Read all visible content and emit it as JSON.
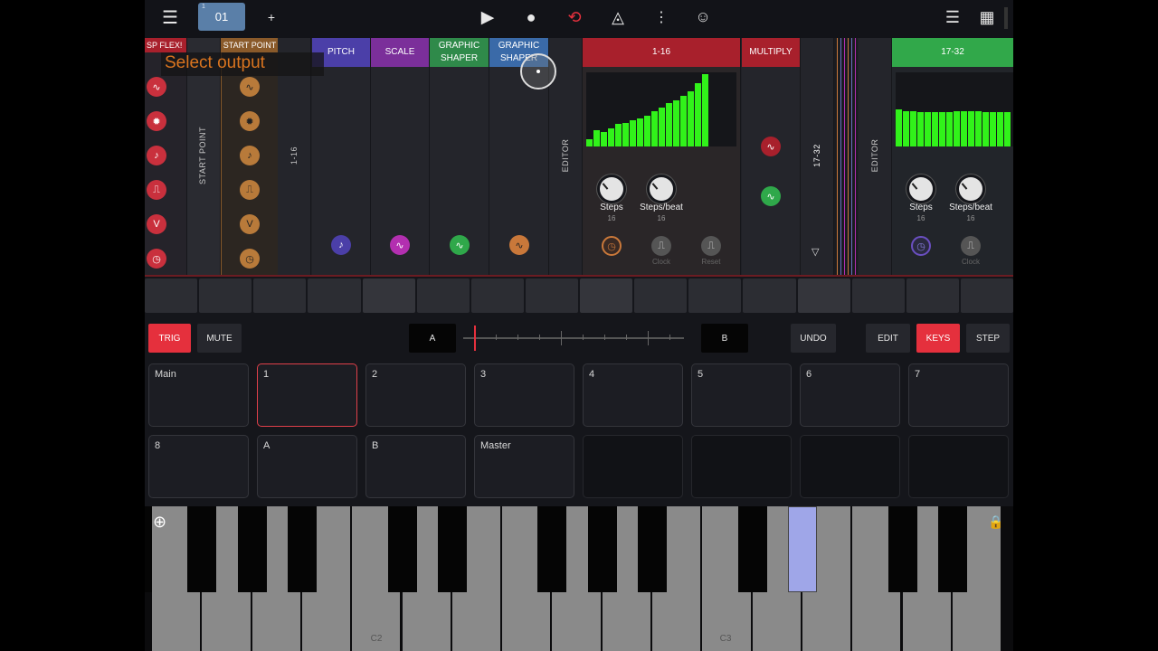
{
  "topbar": {
    "preset_small": "1",
    "preset_label": "01",
    "add_label": "+",
    "play_glyph": "▶",
    "record_glyph": "●",
    "loop_glyph": "⟲",
    "metronome_glyph": "◬",
    "more_glyph": "⋮",
    "face_glyph": "☺",
    "menu_glyph": "☰",
    "list_glyph": "☰",
    "grid_glyph": "▦",
    "accent_color": "#e5303d"
  },
  "overlay": {
    "select_output": "Select output"
  },
  "rack": {
    "modules": [
      {
        "key": "flex",
        "header": "SP FLEX!",
        "header_color": "#a8202c"
      },
      {
        "key": "startpoint_label",
        "vertical": "START POINT"
      },
      {
        "key": "startpoint",
        "header": "START POINT",
        "header_color": "#8a5a2a"
      },
      {
        "key": "range",
        "vertical": "1-16"
      },
      {
        "key": "pitch",
        "header": "PITCH",
        "header_color": "#4b3fa8"
      },
      {
        "key": "scale",
        "header": "SCALE",
        "header_color": "#7b2f9a"
      },
      {
        "key": "graphic1",
        "header": "GRAPHIC\nSHAPER",
        "header_color": "#2f8a4a"
      },
      {
        "key": "graphic2",
        "header": "GRAPHIC\nSHAPER",
        "header_color": "#3a6aa8"
      },
      {
        "key": "editor1",
        "vertical": "EDITOR"
      },
      {
        "key": "seq1",
        "header": "1-16",
        "header_color": "#a8202c"
      },
      {
        "key": "multiply",
        "header": "MULTIPLY",
        "header_color": "#a8202c"
      },
      {
        "key": "range2",
        "vertical": "17-32"
      },
      {
        "key": "editor2",
        "vertical": "EDITOR"
      },
      {
        "key": "seq2",
        "header": "17-32",
        "header_color": "#31a84a"
      }
    ],
    "seq1": {
      "steps_label": "Steps",
      "steps_value": "16",
      "spb_label": "Steps/beat",
      "spb_value": "16",
      "clock_label": "Clock",
      "reset_label": "Reset",
      "bars": [
        0.1,
        0.22,
        0.2,
        0.25,
        0.3,
        0.32,
        0.35,
        0.38,
        0.42,
        0.48,
        0.52,
        0.58,
        0.62,
        0.68,
        0.75,
        0.85,
        0.98
      ]
    },
    "seq2": {
      "steps_label": "Steps",
      "steps_value": "16",
      "spb_label": "Steps/beat",
      "spb_value": "16",
      "clock_label": "Clock",
      "bars": [
        0.5,
        0.48,
        0.47,
        0.46,
        0.46,
        0.46,
        0.46,
        0.46,
        0.47,
        0.47,
        0.47,
        0.47,
        0.46,
        0.46,
        0.46,
        0.46
      ]
    },
    "jack_glyphs": {
      "sine": "∿",
      "pulse": "⎍",
      "note": "♪",
      "clock": "◷",
      "v": "V",
      "blob": "✹",
      "tri": "▽"
    }
  },
  "controls": {
    "trig": "TRIG",
    "mute": "MUTE",
    "a": "A",
    "b": "B",
    "undo": "UNDO",
    "edit": "EDIT",
    "keys": "KEYS",
    "step": "STEP"
  },
  "pads": {
    "row1": [
      "Main",
      "1",
      "2",
      "3",
      "4",
      "5",
      "6",
      "7"
    ],
    "row2": [
      "8",
      "A",
      "B",
      "Master",
      "",
      "",
      "",
      ""
    ]
  },
  "keyboard": {
    "label_c2": "C2",
    "label_c3": "C3",
    "add_glyph": "⊕",
    "lock_glyph": "🔒",
    "highlight_color": "#9fa6e8"
  }
}
